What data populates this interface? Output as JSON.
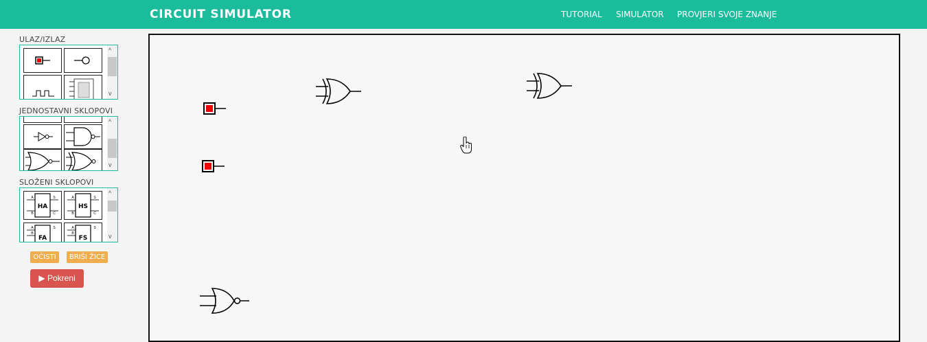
{
  "header": {
    "brand": "CIRCUIT SIMULATOR",
    "links": [
      "TUTORIAL",
      "SIMULATOR",
      "PROVJERI SVOJE ZNANJE"
    ]
  },
  "sidebar": {
    "sections": [
      {
        "title": "ULAZ/IZLAZ",
        "items": [
          "input-switch",
          "output-lamp",
          "clock",
          "seven-segment-display"
        ]
      },
      {
        "title": "JEDNOSTAVNI SKLOPOVI",
        "items": [
          "not-gate",
          "nand-gate",
          "nor-gate",
          "xnor-gate"
        ]
      },
      {
        "title": "SLOŽENI SKLOPOVI",
        "items": [
          "half-adder",
          "half-subtractor",
          "full-adder",
          "full-subtractor"
        ]
      }
    ],
    "chip_labels": {
      "ha": "HA",
      "hs": "HS",
      "fa": "FA",
      "fs": "FS",
      "a": "A",
      "b": "B",
      "s": "S",
      "c": "C"
    },
    "buttons": {
      "clear": "OČISTI",
      "delete_wires": "BRIŠI ŽICE",
      "run": "Pokreni"
    }
  },
  "canvas": {
    "components": [
      "input-switch",
      "input-switch",
      "xor-gate",
      "xor-gate",
      "nor-gate"
    ],
    "cursor": "hand-pointer-icon"
  },
  "colors": {
    "accent": "#1abc9c",
    "warning": "#f0ad4e",
    "danger": "#d9534f",
    "input_fill": "#ee0000"
  }
}
